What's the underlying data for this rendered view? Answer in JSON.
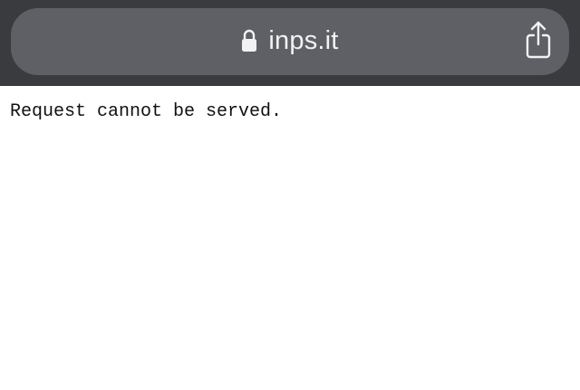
{
  "browser": {
    "url": "inps.it",
    "lock_icon": "lock-icon",
    "share_icon": "share-icon"
  },
  "page": {
    "message": "Request cannot be served."
  },
  "colors": {
    "chrome_background": "#3a3b3f",
    "address_bar_background": "#5e6066",
    "url_text": "#f2f2f4",
    "page_background": "#ffffff",
    "page_text": "#111111"
  }
}
